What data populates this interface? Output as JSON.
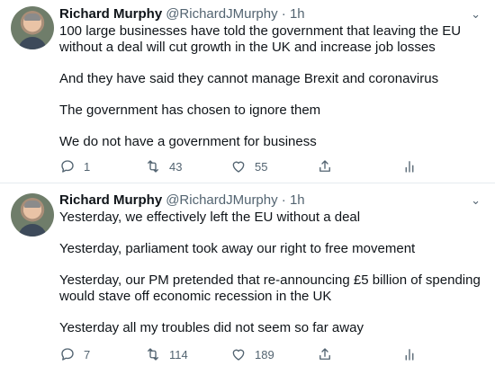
{
  "tweets": [
    {
      "name": "Richard Murphy",
      "handle": "@RichardJMurphy",
      "dot": "·",
      "time": "1h",
      "paragraphs": [
        "100 large businesses have told the government that leaving the EU without a deal will cut growth in the UK and increase job losses",
        "And they have said they cannot manage Brexit and coronavirus",
        "The government has chosen to ignore them",
        "We do not have a government for business"
      ],
      "replies": "1",
      "retweets": "43",
      "likes": "55"
    },
    {
      "name": "Richard Murphy",
      "handle": "@RichardJMurphy",
      "dot": "·",
      "time": "1h",
      "paragraphs": [
        "Yesterday, we effectively left the EU without a deal",
        "Yesterday, parliament took away our right to free movement",
        "Yesterday, our PM pretended that re-announcing £5 billion of spending would stave off economic recession in the UK",
        "Yesterday all my troubles did not seem so far away"
      ],
      "replies": "7",
      "retweets": "114",
      "likes": "189"
    }
  ],
  "icons": {
    "reply": "reply-icon",
    "retweet": "retweet-icon",
    "like": "heart-icon",
    "share": "share-icon",
    "stats": "analytics-icon"
  }
}
